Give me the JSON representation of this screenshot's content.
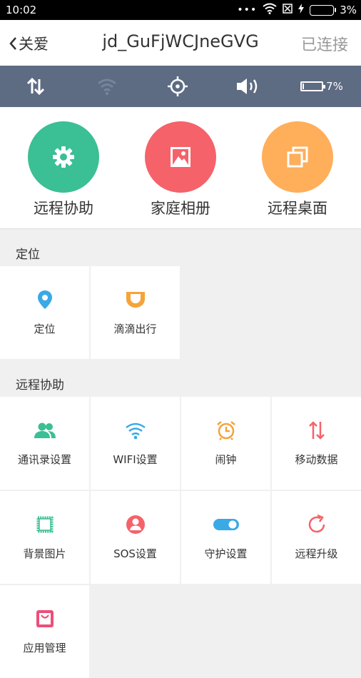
{
  "status_bar": {
    "time": "10:02",
    "battery": "3%"
  },
  "nav": {
    "back_label": "关爱",
    "title": "jd_GuFjWCJneGVG",
    "status": "已连接"
  },
  "device_bar": {
    "battery_percent": "7%"
  },
  "quick_actions": [
    {
      "label": "远程协助",
      "color": "#3bbf95",
      "icon": "gear-icon"
    },
    {
      "label": "家庭相册",
      "color": "#f5626a",
      "icon": "photo-icon"
    },
    {
      "label": "远程桌面",
      "color": "#ffae5a",
      "icon": "windows-icon"
    }
  ],
  "sections": [
    {
      "title": "定位",
      "items": [
        {
          "label": "定位",
          "icon": "location-pin-icon",
          "color": "#3aa9e6"
        },
        {
          "label": "滴滴出行",
          "icon": "didi-icon",
          "color": "#f5a33b"
        }
      ]
    },
    {
      "title": "远程协助",
      "items": [
        {
          "label": "通讯录设置",
          "icon": "contacts-icon",
          "color": "#3bbf95"
        },
        {
          "label": "WIFI设置",
          "icon": "wifi-icon",
          "color": "#3aa9e6"
        },
        {
          "label": "闹钟",
          "icon": "alarm-clock-icon",
          "color": "#f5a33b"
        },
        {
          "label": "移动数据",
          "icon": "data-arrows-icon",
          "color": "#f5626a"
        },
        {
          "label": "背景图片",
          "icon": "wallpaper-icon",
          "color": "#3bbf95"
        },
        {
          "label": "SOS设置",
          "icon": "sos-icon",
          "color": "#f5626a"
        },
        {
          "label": "守护设置",
          "icon": "toggle-icon",
          "color": "#3aa9e6"
        },
        {
          "label": "远程升级",
          "icon": "refresh-icon",
          "color": "#f5626a"
        },
        {
          "label": "应用管理",
          "icon": "bag-icon",
          "color": "#ec4f7a"
        }
      ]
    }
  ]
}
